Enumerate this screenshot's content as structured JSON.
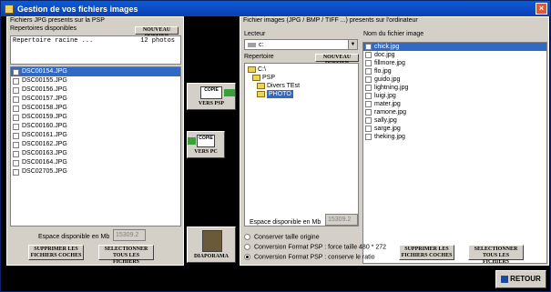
{
  "window": {
    "title": "Gestion de vos fichiers images",
    "close_label": "×"
  },
  "left": {
    "section_label": "Fichiers JPG presents sur la PSP",
    "folders_label": "Repertoires disponibles",
    "new_folder_button": "NOUVEAU DOSSIER",
    "folder_row": {
      "name": "Repertoire racine ...",
      "count": "12 photos"
    },
    "files": [
      "DSC00154.JPG",
      "DSC00155.JPG",
      "DSC00156.JPG",
      "DSC00157.JPG",
      "DSC00158.JPG",
      "DSC00159.JPG",
      "DSC00160.JPG",
      "DSC00161.JPG",
      "DSC00162.JPG",
      "DSC00163.JPG",
      "DSC00164.JPG",
      "DSC02705.JPG"
    ],
    "space_label": "Espace disponible en Mb",
    "space_value": "15309.2",
    "delete_button": [
      "SUPPRIMER LES",
      "FICHIERS COCHES"
    ],
    "select_button": [
      "SELECTIONNER",
      "TOUS LES FICHIERS"
    ]
  },
  "middle": {
    "to_psp": {
      "top": "COPIE",
      "label": "VERS PSP"
    },
    "to_pc": {
      "top": "COPIE",
      "label": "VERS PC"
    },
    "slideshow": "DIAPORAMA"
  },
  "right": {
    "section_label": "Fichier images (JPG / BMP / TIFF ...) presents sur l'ordinateur",
    "drive_label": "Lecteur",
    "drive_value": "c:",
    "folder_label": "Repertoire",
    "new_folder_button": "NOUVEAU DOSSIER",
    "tree": [
      {
        "name": "C:\\",
        "indent": 0
      },
      {
        "name": "PSP",
        "indent": 1
      },
      {
        "name": "Divers TEst",
        "indent": 2
      },
      {
        "name": "PHOTO",
        "indent": 2,
        "selected": true
      }
    ],
    "filename_label": "Nom du fichier image",
    "files": [
      "chick.jpg",
      "doc.jpg",
      "fillmore.jpg",
      "flo.jpg",
      "guido.jpg",
      "lightning.jpg",
      "luigi.jpg",
      "mater.jpg",
      "ramone.jpg",
      "sally.jpg",
      "sarge.jpg",
      "theking.jpg"
    ],
    "space_label": "Espace disponible en Mb",
    "space_value": "15309.2",
    "options": [
      {
        "label": "Conserver taille origine",
        "checked": false
      },
      {
        "label": "Conversion Format PSP : force taille 480 * 272",
        "checked": false
      },
      {
        "label": "Conversion Format PSP : conserve le ratio",
        "checked": true
      }
    ],
    "delete_button": [
      "SUPPRIMER LES",
      "FICHIERS COCHES"
    ],
    "select_button": [
      "SELECTIONNER",
      "TOUS LES FICHIERS"
    ]
  },
  "back_button": "RETOUR"
}
